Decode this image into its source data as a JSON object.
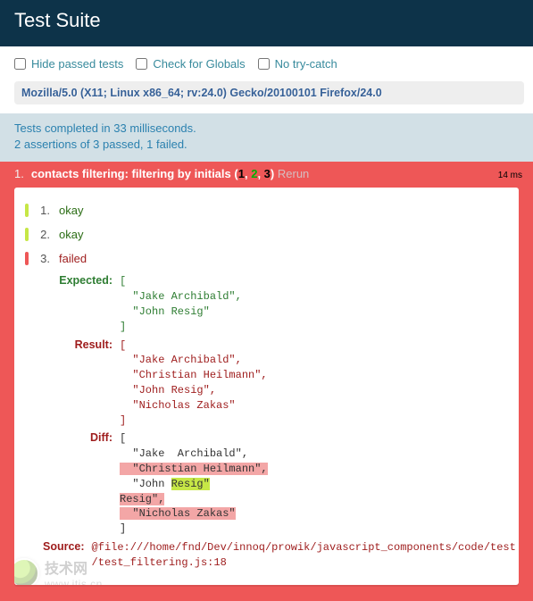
{
  "header": {
    "title": "Test Suite"
  },
  "toolbar": {
    "hide_passed": "Hide passed tests",
    "check_globals": "Check for Globals",
    "no_trycatch": "No try-catch"
  },
  "useragent": "Mozilla/5.0 (X11; Linux x86_64; rv:24.0) Gecko/20100101 Firefox/24.0",
  "summary": {
    "line1": "Tests completed in 33 milliseconds.",
    "line2": "2 assertions of 3 passed, 1 failed."
  },
  "test": {
    "index": "1.",
    "title": "contacts filtering: filtering by initials",
    "counts_open": "(",
    "passed": "1",
    "sep1": ", ",
    "failed": "2",
    "sep2": ", ",
    "total": "3",
    "counts_close": ")",
    "rerun": "Rerun",
    "time": "14 ms"
  },
  "asserts": {
    "a1": {
      "n": "1.",
      "msg": "okay"
    },
    "a2": {
      "n": "2.",
      "msg": "okay"
    },
    "a3": {
      "n": "3.",
      "msg": "failed"
    }
  },
  "labels": {
    "expected": "Expected:",
    "result": "Result:",
    "diff": "Diff:",
    "source": "Source:"
  },
  "expected_code": "[\n  \"Jake Archibald\",\n  \"John Resig\"\n]",
  "result_code": "[\n  \"Jake Archibald\",\n  \"Christian Heilmann\",\n  \"John Resig\",\n  \"Nicholas Zakas\"\n]",
  "diff": {
    "pre1": "[\n  \"Jake  Archibald\",\n",
    "del1": "  \"Christian Heilmann\",",
    "mid1": "\n  \"John ",
    "ins1": "Resig\"",
    "mid2": "\n",
    "del2": "Resig\",",
    "mid3": "\n",
    "del3": "  \"Nicholas Zakas\"",
    "post": "\n]"
  },
  "source_code": "@file:///home/fnd/Dev/innoq/prowik/javascript_components/code/test\n/test_filtering.js:18",
  "watermark": {
    "cn": "技术网",
    "url": "www.itjs.cn"
  }
}
